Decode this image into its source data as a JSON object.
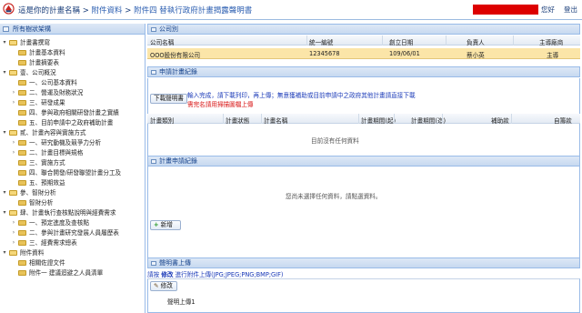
{
  "header": {
    "title": "這是你的計畫名稱",
    "sep1": ">",
    "crumb1": "附件資料",
    "sep2": ">",
    "crumb2": "附件四 替執行政府計畫揭露聲明書",
    "greet": "您好",
    "logout": "登出"
  },
  "sidebar": {
    "title": "所有樹狀架構",
    "items": [
      {
        "label": "計畫書撰寫",
        "arrow": "▾"
      },
      {
        "label": "計畫基本資料",
        "arrow": ""
      },
      {
        "label": "計畫摘要表",
        "arrow": ""
      },
      {
        "label": "壹、公司概況",
        "arrow": "▾"
      },
      {
        "label": "一、公司基本資料",
        "arrow": ""
      },
      {
        "label": "二、營運及財務狀況",
        "arrow": "›"
      },
      {
        "label": "三、研發成果",
        "arrow": "›"
      },
      {
        "label": "四、參與政府相關研發計畫之實績",
        "arrow": ""
      },
      {
        "label": "五、目前申請中之政府補助計畫",
        "arrow": ""
      },
      {
        "label": "貳、計畫內容與實施方式",
        "arrow": "▾"
      },
      {
        "label": "一、研究動機及競爭力分析",
        "arrow": "›"
      },
      {
        "label": "二、計畫目標與規格",
        "arrow": "›"
      },
      {
        "label": "三、實施方式",
        "arrow": ""
      },
      {
        "label": "四、聯合開發/研發聯盟計畫分工及",
        "arrow": ""
      },
      {
        "label": "五、預期效益",
        "arrow": ""
      },
      {
        "label": "參、智財分析",
        "arrow": "▾"
      },
      {
        "label": "智財分析",
        "arrow": ""
      },
      {
        "label": "肆、計畫執行查核點說明與經費需求",
        "arrow": "▾"
      },
      {
        "label": "一、預定進度及查核點",
        "arrow": "›"
      },
      {
        "label": "二、參與計畫研究發展人員履歷表",
        "arrow": "›"
      },
      {
        "label": "三、經費需求總表",
        "arrow": "›"
      },
      {
        "label": "附件資料",
        "arrow": "▾"
      },
      {
        "label": "相關佐證文件",
        "arrow": ""
      },
      {
        "label": "附件一 建議迴避之人員清單",
        "arrow": ""
      }
    ]
  },
  "company_panel": {
    "title": "公司別",
    "columns": [
      "公司名稱",
      "統一編號",
      "創立日期",
      "負責人",
      "主導廠商"
    ],
    "row": [
      "OOO股份有限公司",
      "12345678",
      "109/06/01",
      "蔡小英",
      "主導"
    ]
  },
  "apply_panel": {
    "title": "申請計畫紀錄",
    "download_btn": "下載聲明書",
    "info_blue": "輸入完成，請下載列印，再上傳；無意獲補助或目前申請中之政府其他計畫請直接下載",
    "info_red": "需完名請用掃描圖檔上傳",
    "columns": [
      "計畫類別",
      "計畫狀態",
      "計畫名稱",
      "計畫期間(起)",
      "計畫期間(迄)",
      "補助款",
      "自籌款"
    ],
    "empty": "目前沒有任何資料"
  },
  "plan_panel": {
    "title": "計畫申請紀錄",
    "empty": "您尚未選擇任何資料，請點選資料。",
    "add_btn": "新增"
  },
  "upload_panel": {
    "title": "聲明書上傳",
    "link1": "請按",
    "link2": "修改",
    "desc": "進行附件上傳(JPG;JPEG;PNG;BMP;GIF)",
    "edit_btn": "修改",
    "file_label": "聲明上傳1"
  },
  "colors": {
    "header_user_block": "#dd0000",
    "selected_row": "#fbe5a8",
    "panel_bar": "#c7d9f0"
  }
}
